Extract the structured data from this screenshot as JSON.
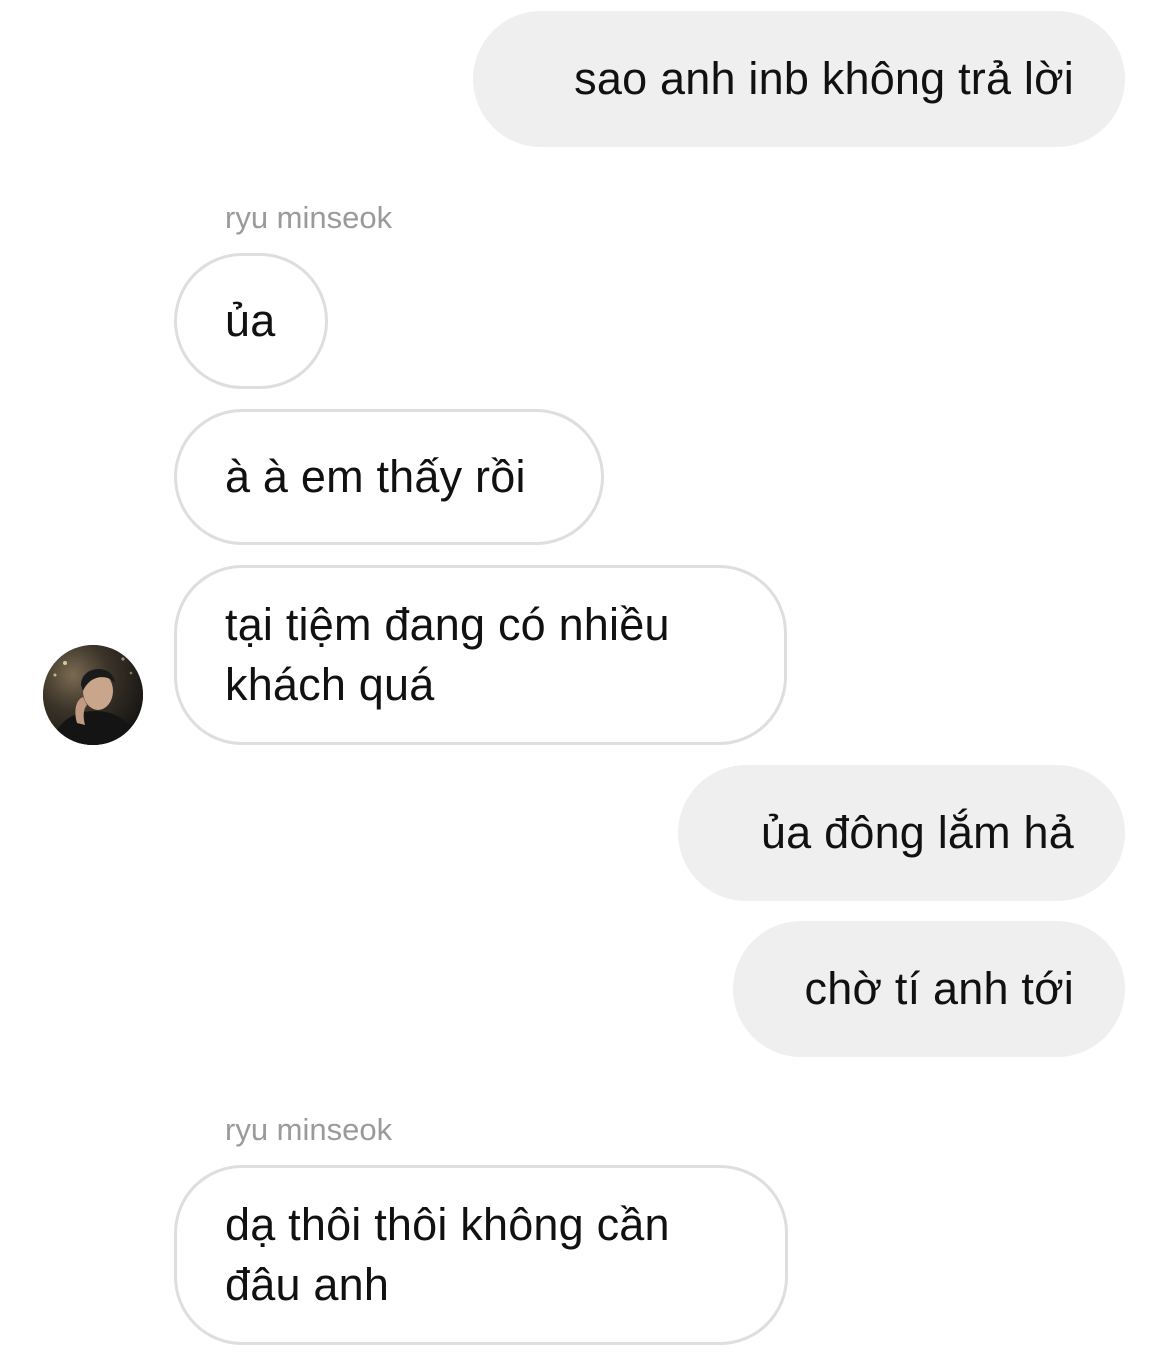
{
  "thread": {
    "messages": [
      {
        "sender": "me",
        "text": "sao anh inb không trả lời"
      },
      {
        "sender": "ryu minseok",
        "show_name": "ryu minseok",
        "text": "ủa"
      },
      {
        "sender": "ryu minseok",
        "text": "à à em thấy rồi"
      },
      {
        "sender": "ryu minseok",
        "text": "tại tiệm đang có nhiều khách quá",
        "line1": "tại tiệm đang có nhiều",
        "line2": "khách quá"
      },
      {
        "sender": "me",
        "text": "ủa đông lắm hả"
      },
      {
        "sender": "me",
        "text": "chờ tí anh tới"
      },
      {
        "sender": "ryu minseok",
        "show_name": "ryu minseok",
        "text": "dạ thôi thôi không cần đâu anh",
        "line1": "dạ thôi thôi không cần",
        "line2": "đâu anh"
      }
    ]
  },
  "colors": {
    "outgoing_bubble": "#efefef",
    "incoming_border": "#dedede",
    "sender_name": "#9a9a9a",
    "text": "#111111"
  },
  "icons": {
    "avatar": "contact-avatar-photo"
  }
}
